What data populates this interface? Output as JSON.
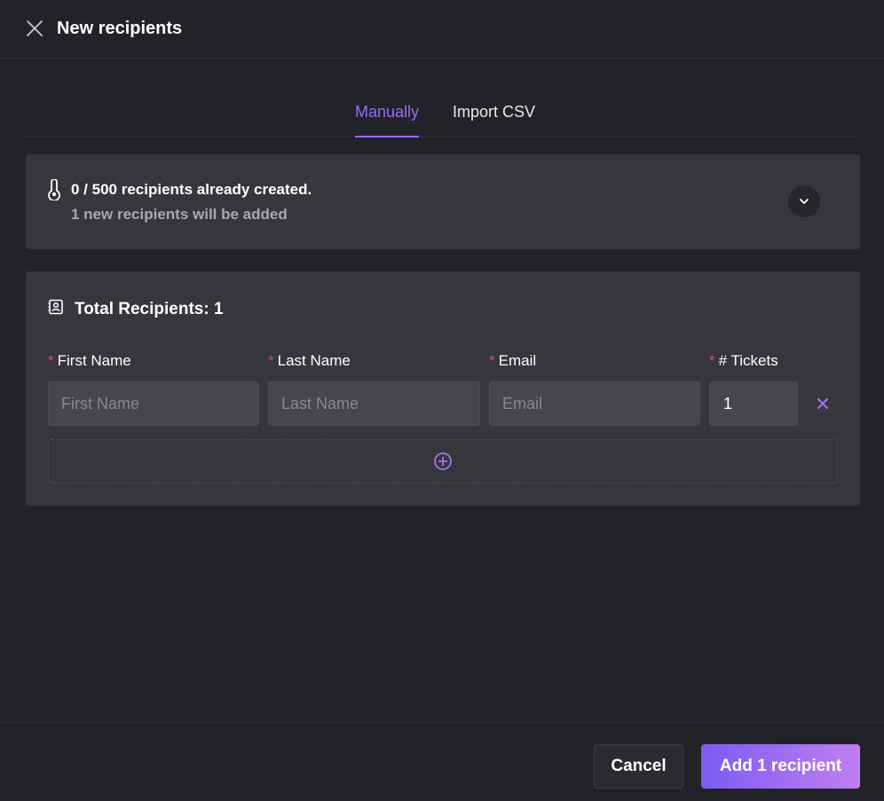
{
  "header": {
    "title": "New recipients",
    "close_icon": "close-icon"
  },
  "tabs": [
    {
      "label": "Manually",
      "active": true
    },
    {
      "label": "Import CSV",
      "active": false
    }
  ],
  "info": {
    "icon": "thermometer-icon",
    "summary": "0 / 500 recipients already created.",
    "detail": "1 new recipients will be added",
    "expand_icon": "chevron-down-icon"
  },
  "form": {
    "icon": "contacts-icon",
    "total_label": "Total Recipients: 1",
    "required_marker": "*",
    "columns": {
      "first_name": {
        "label": "First Name",
        "placeholder": "First Name",
        "value": ""
      },
      "last_name": {
        "label": "Last Name",
        "placeholder": "Last Name",
        "value": ""
      },
      "email": {
        "label": "Email",
        "placeholder": "Email",
        "value": ""
      },
      "tickets": {
        "label": "# Tickets",
        "value": "1"
      }
    },
    "remove_icon": "close-icon",
    "add_row_icon": "plus-circle-icon"
  },
  "footer": {
    "cancel_label": "Cancel",
    "submit_label": "Add 1 recipient"
  },
  "colors": {
    "accent": "#9b6bf0",
    "background": "#212328",
    "card": "#36373c",
    "required": "#e5484d",
    "submit_gradient_start": "#7b5cf2",
    "submit_gradient_end": "#c07ef0"
  }
}
